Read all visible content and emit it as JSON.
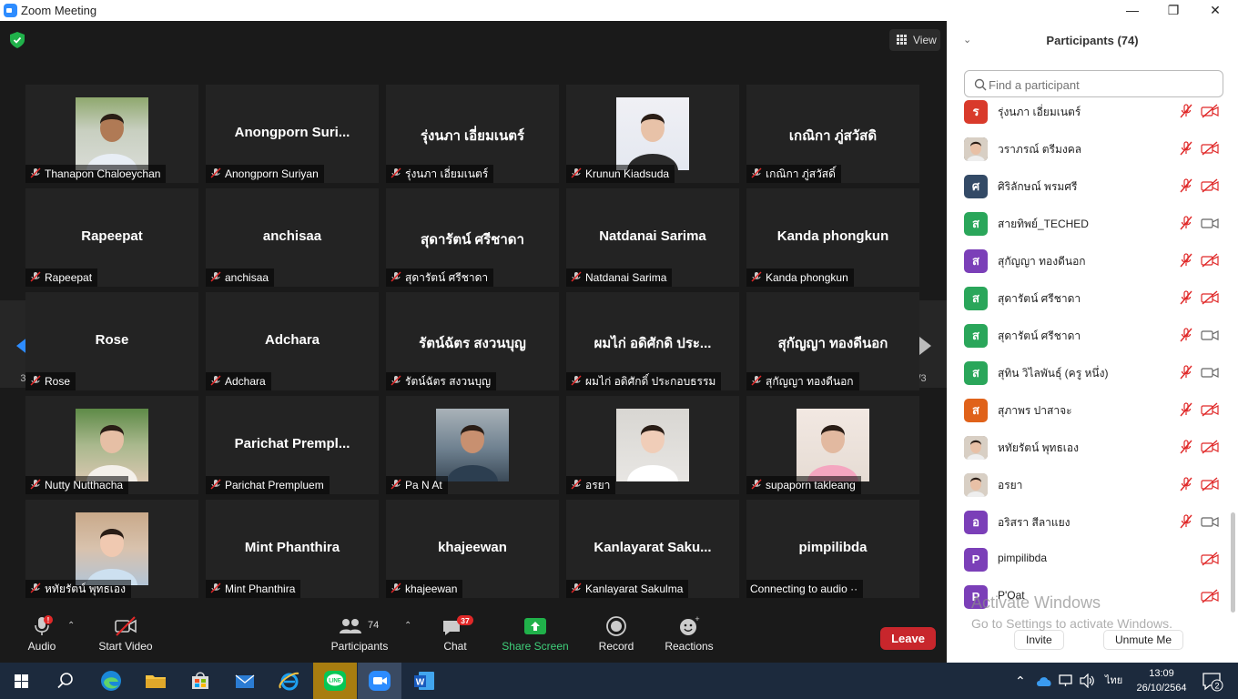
{
  "window": {
    "title": "Zoom Meeting",
    "controls": [
      "—",
      "❐",
      "✕"
    ]
  },
  "view_label": "View",
  "page_indicator": "3/3",
  "tiles": [
    {
      "big": "",
      "name": "Thanapon Chaloeychan",
      "photo": "photo-man"
    },
    {
      "big": "Anongporn  Suri...",
      "name": "Anongporn Suriyan"
    },
    {
      "big": "รุ่งนภา เอี่ยมเนตร์",
      "name": "รุ่งนภา เอี่ยมเนตร์"
    },
    {
      "big": "",
      "name": "Krunun Kiadsuda",
      "photo": "photo-woman-white"
    },
    {
      "big": "เกณิกา ภู่สวัสดิ",
      "name": "เกณิกา ภู่สวัสดิ์"
    },
    {
      "big": "Rapeepat",
      "name": "Rapeepat"
    },
    {
      "big": "anchisaa",
      "name": "anchisaa"
    },
    {
      "big": "สุดารัตน์ ศรีชาดา",
      "name": "สุดารัตน์ ศรีชาดา"
    },
    {
      "big": "Natdanai Sarima",
      "name": "Natdanai Sarima"
    },
    {
      "big": "Kanda phongkun",
      "name": "Kanda phongkun"
    },
    {
      "big": "Rose",
      "name": "Rose"
    },
    {
      "big": "Adchara",
      "name": "Adchara"
    },
    {
      "big": "รัตน์ฉัตร สงวนบุญ",
      "name": "รัตน์ฉัตร สงวนบุญ"
    },
    {
      "big": "ผมไก่ อดิศักดิ ประ...",
      "name": "ผมไก่ อดิศักดิ์ ประกอบธรรม"
    },
    {
      "big": "สุกัญญา ทองดีนอก",
      "name": "สุกัญญา ทองดีนอก"
    },
    {
      "big": "",
      "name": "Nutty Nutthacha",
      "photo": "photo-woman-green"
    },
    {
      "big": "Parichat  Prempl...",
      "name": "Parichat Prempluem"
    },
    {
      "big": "",
      "name": "Pa N At",
      "photo": "photo-classroom"
    },
    {
      "big": "",
      "name": "อรยา",
      "photo": "photo-woman-nurse"
    },
    {
      "big": "",
      "name": "supaporn takleang",
      "photo": "photo-woman-pink"
    },
    {
      "big": "",
      "name": "หทัยรัตน์ พุทธเอง",
      "photo": "photo-woman-blue"
    },
    {
      "big": "Mint Phanthira",
      "name": "Mint Phanthira"
    },
    {
      "big": "khajeewan",
      "name": "khajeewan"
    },
    {
      "big": "Kanlayarat  Saku...",
      "name": "Kanlayarat Sakulma"
    },
    {
      "big": "pimpilibda",
      "name": "Connecting to audio ··"
    }
  ],
  "toolbar": {
    "audio": "Audio",
    "start_video": "Start Video",
    "participants": "Participants",
    "participants_count": "74",
    "chat": "Chat",
    "chat_badge": "37",
    "share_screen": "Share Screen",
    "record": "Record",
    "reactions": "Reactions",
    "leave": "Leave",
    "audio_alert": "!"
  },
  "panel": {
    "title": "Participants (74)",
    "search_placeholder": "Find a participant",
    "participants": [
      {
        "initial": "ร",
        "color": "#d93a2b",
        "name": "รุ่งนภา เอี่ยมเนตร์",
        "mic": "muted",
        "video": "off"
      },
      {
        "initial": "",
        "color": "#444444",
        "name": "วราภรณ์ ตรีมงคล",
        "mic": "muted",
        "video": "off",
        "avatar_photo": true
      },
      {
        "initial": "ศ",
        "color": "#334a66",
        "name": "ศิริลักษณ์ พรมศรี",
        "mic": "muted",
        "video": "off"
      },
      {
        "initial": "ส",
        "color": "#2aa65a",
        "name": "สายทิพย์_TECHED",
        "mic": "muted",
        "video": "on"
      },
      {
        "initial": "ส",
        "color": "#7b3fb8",
        "name": "สุกัญญา ทองดีนอก",
        "mic": "muted",
        "video": "off"
      },
      {
        "initial": "ส",
        "color": "#2aa65a",
        "name": "สุดารัตน์ ศรีชาดา",
        "mic": "muted",
        "video": "off"
      },
      {
        "initial": "ส",
        "color": "#2aa65a",
        "name": "สุดารัตน์ ศรีชาดา",
        "mic": "muted",
        "video": "on"
      },
      {
        "initial": "ส",
        "color": "#2aa65a",
        "name": "สุทิน วิไลพันธุ์ (ครู หนึ่ง)",
        "mic": "muted",
        "video": "on"
      },
      {
        "initial": "ส",
        "color": "#e0621a",
        "name": "สุภาพร ปาสาจะ",
        "mic": "muted",
        "video": "off"
      },
      {
        "initial": "",
        "color": "#888888",
        "name": "หทัยรัตน์ พุทธเอง",
        "mic": "muted",
        "video": "off",
        "avatar_photo": true
      },
      {
        "initial": "",
        "color": "#bbbbbb",
        "name": "อรยา",
        "mic": "muted",
        "video": "off",
        "avatar_photo": true
      },
      {
        "initial": "อ",
        "color": "#7b3fb8",
        "name": "อริสรา สีลาแยง",
        "mic": "muted",
        "video": "on"
      },
      {
        "initial": "P",
        "color": "#7b3fb8",
        "name": "pimpilibda",
        "mic": "none",
        "video": "off"
      },
      {
        "initial": "P",
        "color": "#7b3fb8",
        "name": "P'Oat",
        "mic": "none",
        "video": "off"
      }
    ],
    "invite": "Invite",
    "unmute_me": "Unmute Me"
  },
  "watermark": {
    "line1": "Activate Windows",
    "line2": "Go to Settings to activate Windows."
  },
  "taskbar": {
    "lang": "ไทย",
    "time": "13:09",
    "date": "26/10/2564",
    "notif_count": "2"
  }
}
